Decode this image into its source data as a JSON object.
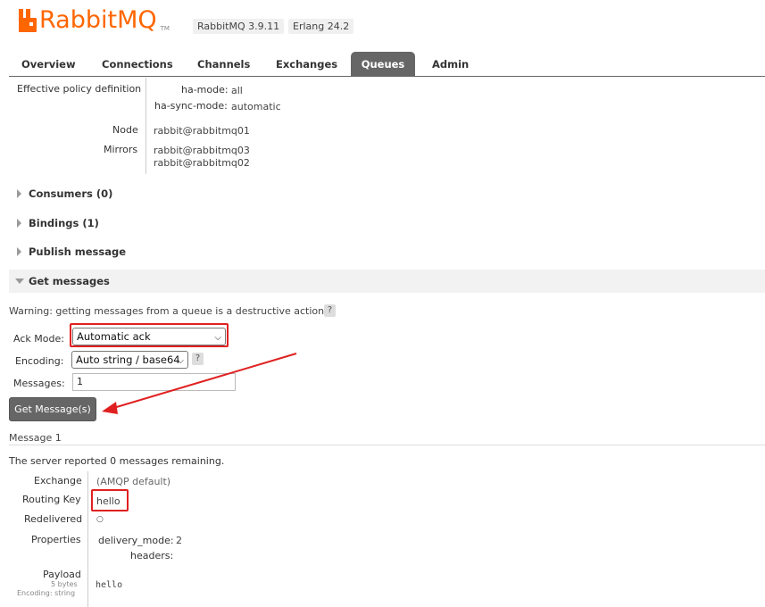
{
  "header": {
    "logo_text": "RabbitMQ",
    "logo_tm": "TM",
    "version": "RabbitMQ 3.9.11",
    "erlang": "Erlang 24.2",
    "brand_color": "#ff6600"
  },
  "tabs": [
    {
      "label": "Overview"
    },
    {
      "label": "Connections"
    },
    {
      "label": "Channels"
    },
    {
      "label": "Exchanges"
    },
    {
      "label": "Queues",
      "active": true
    },
    {
      "label": "Admin"
    }
  ],
  "details": {
    "policy_label": "Effective policy definition",
    "policy": [
      {
        "key": "ha-mode:",
        "value": "all"
      },
      {
        "key": "ha-sync-mode:",
        "value": "automatic"
      }
    ],
    "node_label": "Node",
    "node_value": "rabbit@rabbitmq01",
    "mirrors_label": "Mirrors",
    "mirrors": [
      "rabbit@rabbitmq03",
      "rabbit@rabbitmq02"
    ]
  },
  "sections": {
    "consumers": "Consumers (0)",
    "bindings": "Bindings (1)",
    "publish": "Publish message",
    "get": "Get messages"
  },
  "get_messages": {
    "warning": "Warning: getting messages from a queue is a destructive action.",
    "help": "?",
    "ack_mode_label": "Ack Mode:",
    "ack_mode_value": "Automatic ack",
    "encoding_label": "Encoding:",
    "encoding_value": "Auto string / base64",
    "messages_label": "Messages:",
    "messages_value": "1",
    "button_label": "Get Message(s)"
  },
  "result": {
    "title": "Message 1",
    "remaining": "The server reported 0 messages remaining.",
    "exchange_label": "Exchange",
    "exchange_value": "(AMQP default)",
    "routing_key_label": "Routing Key",
    "routing_key_value": "hello",
    "redelivered_label": "Redelivered",
    "redelivered_value": "○",
    "properties_label": "Properties",
    "delivery_mode_key": "delivery_mode:",
    "delivery_mode_value": "2",
    "headers_key": "headers:",
    "payload_label": "Payload",
    "payload_size": "5 bytes",
    "payload_encoding": "Encoding: string",
    "payload_value": "hello"
  },
  "annotation_color": "#e02020"
}
